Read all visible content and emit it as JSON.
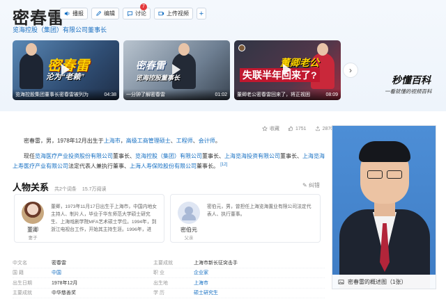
{
  "header": {
    "title": "密春雷",
    "subtitle": "览海控股（集团）有限公司董事长",
    "actions": {
      "play": "播报",
      "edit": "编辑",
      "discuss": "讨论",
      "discuss_badge": "7",
      "upload": "上传视频",
      "add": "+"
    }
  },
  "videos": [
    {
      "headline_a": "密春雷",
      "headline_b": "沦为“老赖”",
      "caption": "览海控股集团董事长密春雷被列为",
      "duration": "04:38"
    },
    {
      "headline_a": "密春雷",
      "headline_b": "览海控股董事长",
      "caption": "一分钟了解密春雷",
      "duration": "01:02"
    },
    {
      "headline_a": "董卿老公",
      "headline_b": "失联半年回来了?",
      "caption": "董卿老公密春雷回来了，将正视困",
      "duration": "08:09"
    }
  ],
  "brand": {
    "name": "秒懂百科",
    "slogan": "一看就懂的视频百科"
  },
  "stats": {
    "collect": "收藏",
    "likes": "1751",
    "shares": "2870"
  },
  "intro": {
    "p1_prefix": "密春雷，男，1978年12月出生于",
    "p1_link1": "上海市",
    "p1_sep1": "，",
    "p1_link2": "高级工商管理硕士",
    "p1_sep2": "、",
    "p1_link3": "工程师",
    "p1_sep3": "、",
    "p1_link4": "会计师",
    "p1_end": "。",
    "p2_prefix": "现任",
    "p2_link1": "览海医疗产业投资股份有限公司",
    "p2_t1": "董事长、",
    "p2_link2": "览海控股（集团）有限公司",
    "p2_t2": "董事长、",
    "p2_link3": "上海览海投资有限公司",
    "p2_t3": "董事长、",
    "p2_link4": "上海览海上寿医疗产业有限公司",
    "p2_t4": "法定代表人兼执行董事、",
    "p2_link5": "上海人寿保险股份有限公司",
    "p2_t5": "董事长。",
    "ref": "[12]"
  },
  "relations": {
    "title": "人物关系",
    "meta1": "共2个词条",
    "meta2": "15.7万阅读",
    "report": "纠错",
    "cards": [
      {
        "name": "董卿",
        "role": "妻子",
        "desc": "董卿，1973年11月17日出生于上海市，中国内地女主持人、制片人，毕业于华东师范大学硕士研究生、上海戏剧学院MFA艺术硕士学位。1994年，到浙江电视台工作，开始其主持生涯。1996年，进"
      },
      {
        "name": "密伯元",
        "role": "父亲",
        "desc": "密伯元，男，曾担任上海览海置业有限公司法定代表人、执行董事。"
      }
    ]
  },
  "info": [
    {
      "k1": "中文名",
      "v1": "密春雷",
      "v1_link": false,
      "k2": "主要成就",
      "v2": "上海市新长征突击手",
      "v2_link": false
    },
    {
      "k1": "国    籍",
      "v1": "中国",
      "v1_link": true,
      "k2": "职    业",
      "v2": "企业家",
      "v2_link": true
    },
    {
      "k1": "出生日期",
      "v1": "1978年12月",
      "v1_link": false,
      "k2": "出生地",
      "v2": "上海市",
      "v2_link": true
    },
    {
      "k1": "主要成就",
      "v1": "中华慈善奖",
      "v1_link": false,
      "k2": "学    历",
      "v2": "硕士研究生",
      "v2_link": true
    }
  ],
  "portrait": {
    "caption": "密春雷的概述图（1张）"
  },
  "colors": {
    "link": "#136ec2",
    "accent": "#e4393c",
    "portrait_bg": "#4d8ed6"
  }
}
